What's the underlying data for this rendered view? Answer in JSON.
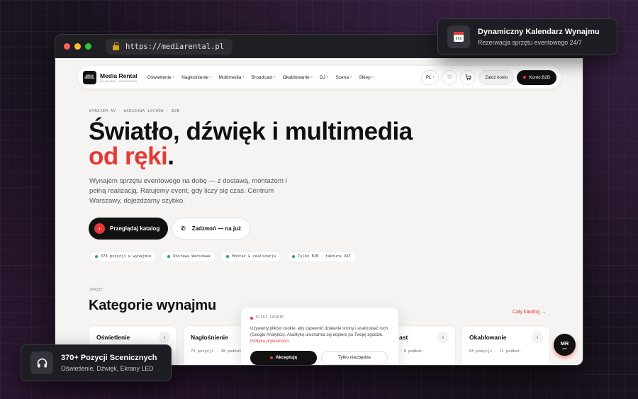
{
  "browser": {
    "url": "https://mediarental.pl"
  },
  "nav": {
    "brand_name": "Media Rental",
    "brand_sub": "WYNAJEM · WARSZAWA",
    "menu": [
      "Oświetlenie",
      "Nagłośnienie",
      "Multimedia",
      "Broadcast",
      "Okablowanie",
      "DJ",
      "Scena",
      "Sklep"
    ],
    "lang": "PL",
    "register": "Załóż konto",
    "b2b": "Konto B2B"
  },
  "hero": {
    "eyebrow": "WYNAJEM AV · WARSZAWA ŁOCHÓW · B2B",
    "title_line1": "Światło, dźwięk i multimedia",
    "title_line2": "od ręki",
    "title_dot": ".",
    "lead": "Wynajem sprzętu eventowego na dobę — z dostawą, montażem i pełną realizacją. Ratujemy event, gdy liczy się czas. Centrum Warszawy, dojeżdżamy szybko.",
    "cta_primary": "Przeglądaj katalog",
    "cta_secondary": "Zadzwoń — na już",
    "chips": [
      "378 pozycji w wynajmie",
      "Dostawa Warszawa",
      "Montaż & realizacja",
      "Tylko B2B · faktura VAT"
    ]
  },
  "categories": {
    "eyebrow": "SPRZĘT",
    "title": "Kategorie wynajmu",
    "catalog_link": "Cały katalog →",
    "items": [
      {
        "name": "Oświetlenie",
        "meta": ""
      },
      {
        "name": "Nagłośnienie",
        "meta": "73 pozycji · 10 podkat."
      },
      {
        "name": "ast",
        "meta": "· 9 podkat."
      },
      {
        "name": "Okablowanie",
        "meta": "65 pozycji · 11 podkat."
      }
    ]
  },
  "cookie": {
    "heading": "PLIKI COOKIE",
    "body": "Używamy plików cookie, aby zapewnić działanie strony i analizować ruch (Google Analytics). Analitykę uruchamia się dopiero po Twojej zgodzie.",
    "policy_link": "Polityka prywatności.",
    "accept": "Akceptuję",
    "necessary": "Tylko niezbędne"
  },
  "fab": {
    "label": "MR",
    "sub": "B2B"
  },
  "badge_calendar": {
    "title": "Dynamiczny Kalendarz Wynajmu",
    "subtitle": "Rezerwacja sprzętu eventowego 24/7",
    "icon": "calendar-icon"
  },
  "badge_positions": {
    "title": "370+ Pozycji Scenicznych",
    "subtitle": "Oświetlenie, Dźwięk, Ekrany LED",
    "icon": "headphones-icon"
  },
  "colors": {
    "accent": "#e53935",
    "dark": "#111111",
    "success": "#26a65b",
    "background": "#1b1320"
  }
}
